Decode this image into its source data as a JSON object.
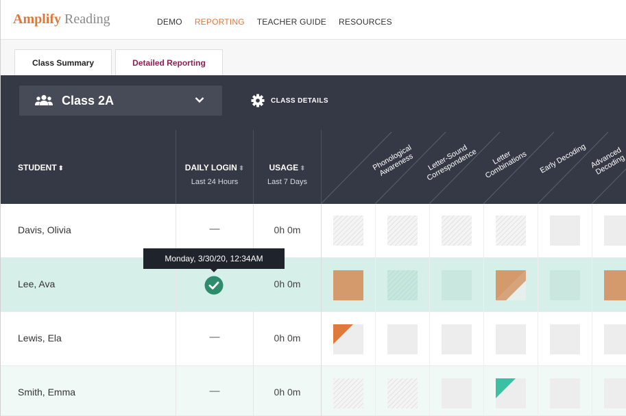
{
  "app": {
    "brand": "Amplify",
    "product": "Reading"
  },
  "nav": {
    "links": [
      {
        "label": "DEMO",
        "active": false
      },
      {
        "label": "REPORTING",
        "active": true
      },
      {
        "label": "TEACHER GUIDE",
        "active": false
      },
      {
        "label": "RESOURCES",
        "active": false
      }
    ]
  },
  "tabs": [
    {
      "label": "Class Summary",
      "active": false
    },
    {
      "label": "Detailed Reporting",
      "active": true
    }
  ],
  "class_selector": {
    "value": "Class 2A",
    "icon": "people-icon"
  },
  "class_details": {
    "label": "CLASS DETAILS",
    "icon": "gear-icon"
  },
  "columns": {
    "student": "STUDENT",
    "daily_login": {
      "title": "DAILY LOGIN",
      "sub": "Last 24 Hours"
    },
    "usage": {
      "title": "USAGE",
      "sub": "Last 7 Days"
    },
    "skills": [
      {
        "line1": "Phonological",
        "line2": "Awareness"
      },
      {
        "line1": "Letter-Sound",
        "line2": "Correspondence"
      },
      {
        "line1": "Letter",
        "line2": "Combinations"
      },
      {
        "line1": "Early Decoding",
        "line2": ""
      },
      {
        "line1": "Advanced",
        "line2": "Decoding"
      }
    ]
  },
  "tooltip": "Monday, 3/30/20, 12:34AM",
  "students": [
    {
      "name": "Davis, Olivia",
      "login": "—",
      "usage": "0h 0m",
      "skills": [
        "hatched",
        "hatched",
        "hatched",
        "hatched",
        "empty",
        "empty"
      ]
    },
    {
      "name": "Lee, Ava",
      "login": "check",
      "usage": "0h 0m",
      "skills": [
        "orange-full",
        "hatched-teal",
        "empty-light",
        "orange-diagonal",
        "empty-light",
        "orange-full"
      ]
    },
    {
      "name": "Lewis, Ela",
      "login": "—",
      "usage": "0h 0m",
      "skills": [
        "orange-corner",
        "empty",
        "empty",
        "empty",
        "empty",
        "empty"
      ]
    },
    {
      "name": "Smith, Emma",
      "login": "—",
      "usage": "0h 0m",
      "skills": [
        "hatched",
        "hatched",
        "empty",
        "teal-corner",
        "empty",
        "empty"
      ]
    }
  ],
  "colors": {
    "accent": "#e0773a",
    "tab_active": "#8b2252",
    "header_bg": "#343945",
    "highlight_row": "#d6efe9",
    "check": "#2e8b6b",
    "teal": "#3cbfa3"
  }
}
